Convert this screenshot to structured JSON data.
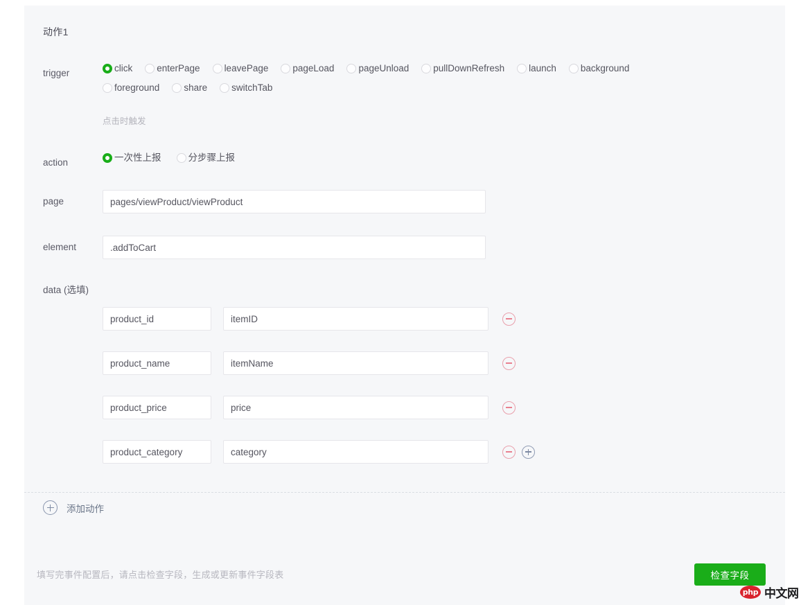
{
  "panel": {
    "action_title": "动作1"
  },
  "trigger": {
    "label": "trigger",
    "hint": "点击时触发",
    "selected": "click",
    "options": [
      {
        "value": "click",
        "label": "click"
      },
      {
        "value": "enterPage",
        "label": "enterPage"
      },
      {
        "value": "leavePage",
        "label": "leavePage"
      },
      {
        "value": "pageLoad",
        "label": "pageLoad"
      },
      {
        "value": "pageUnload",
        "label": "pageUnload"
      },
      {
        "value": "pullDownRefresh",
        "label": "pullDownRefresh"
      },
      {
        "value": "launch",
        "label": "launch"
      },
      {
        "value": "background",
        "label": "background"
      },
      {
        "value": "foreground",
        "label": "foreground"
      },
      {
        "value": "share",
        "label": "share"
      },
      {
        "value": "switchTab",
        "label": "switchTab"
      }
    ]
  },
  "action": {
    "label": "action",
    "selected": "一次性上报",
    "options": [
      {
        "value": "once",
        "label": "一次性上报"
      },
      {
        "value": "step",
        "label": "分步骤上报"
      }
    ]
  },
  "page": {
    "label": "page",
    "value": "pages/viewProduct/viewProduct",
    "placeholder": "pages/viewProduct/viewProduct"
  },
  "element": {
    "label": "element",
    "value": ".addToCart",
    "placeholder": ".addToCart"
  },
  "data_section": {
    "label": "data (选填)",
    "rows": [
      {
        "key": "product_id",
        "value": "itemID",
        "remove_icon": "minus-circle-icon",
        "add_icon": null
      },
      {
        "key": "product_name",
        "value": "itemName",
        "remove_icon": "minus-circle-icon",
        "add_icon": null
      },
      {
        "key": "product_price",
        "value": "price",
        "remove_icon": "minus-circle-icon",
        "add_icon": null
      },
      {
        "key": "product_category",
        "value": "category",
        "remove_icon": "minus-circle-icon",
        "add_icon": "plus-circle-icon"
      }
    ]
  },
  "add_action": {
    "label": "添加动作",
    "icon": "plus-circle-icon"
  },
  "footer": {
    "note": "填写完事件配置后，请点击检查字段，生成或更新事件字段表",
    "button_label": "检查字段"
  },
  "watermark": {
    "badge": "php",
    "text": "中文网"
  },
  "colors": {
    "accent_green": "#1aad19",
    "panel_bg": "#f6f7f9",
    "remove_red": "#e9808f",
    "add_blue_gray": "#7d8aa3"
  }
}
